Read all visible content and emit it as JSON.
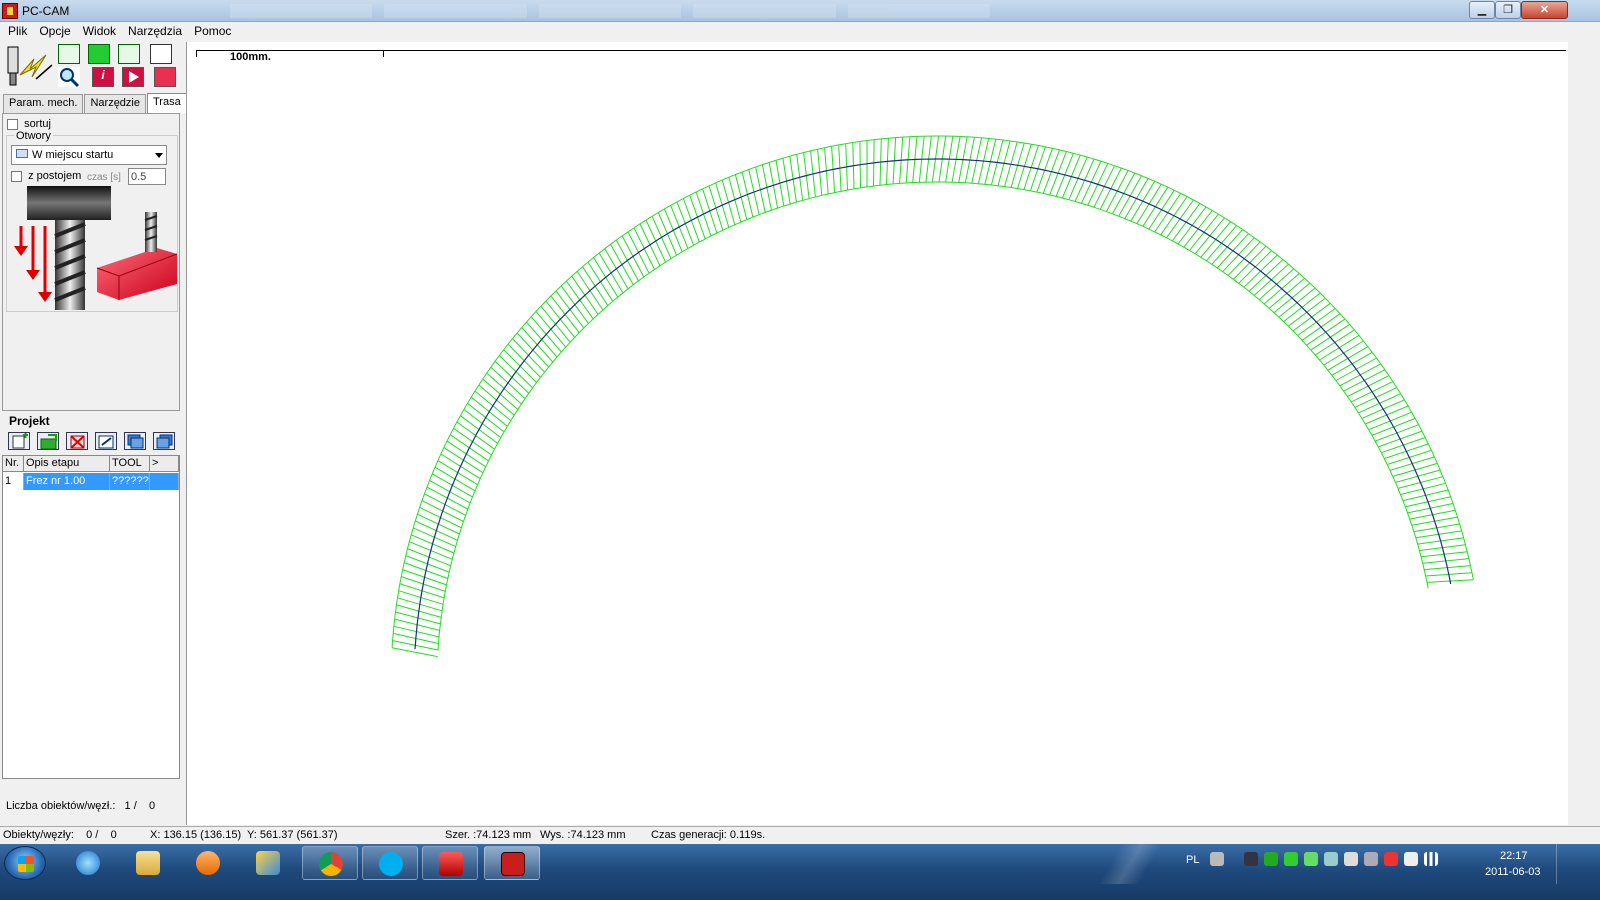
{
  "window": {
    "title": "PC-CAM"
  },
  "menu": [
    "Plik",
    "Opcje",
    "Widok",
    "Narzędzia",
    "Pomoc"
  ],
  "tabs": [
    {
      "label": "Param. mech.",
      "active": false
    },
    {
      "label": "Narzędzie",
      "active": false
    },
    {
      "label": "Trasa",
      "active": true
    }
  ],
  "trasa": {
    "sortuj_label": "sortuj",
    "sortuj_checked": false,
    "otwory_label": "Otwory",
    "otwory_select": "W miejscu startu",
    "postoj_label": "z postojem",
    "postoj_checked": false,
    "czas_label": "czas [s]",
    "czas_value": "0.5"
  },
  "projekt": {
    "title": "Projekt",
    "columns": [
      "Nr.",
      "Opis etapu",
      "TOOL",
      ">"
    ],
    "rows": [
      {
        "nr": "1",
        "opis": "Frez nr 1.00",
        "tool": "??????"
      }
    ],
    "liczba_label": "Liczba obiektów/węzł.:",
    "liczba_value": "1 /    0"
  },
  "canvas": {
    "ruler_label": "100mm."
  },
  "statusbar": {
    "obiekty": "Obiekty/węzły:    0 /    0",
    "x": "X: 136.15 (136.15)",
    "y": "Y: 561.37 (561.37)",
    "szer": "Szer. :74.123 mm",
    "wys": "Wys. :74.123 mm",
    "czas": "Czas generacji: 0.119s."
  },
  "taskbar": {
    "lang": "PL",
    "time": "22:17",
    "date": "2011-06-03"
  },
  "colors": {
    "path": "#1a2a8a",
    "offset": "#22dd22",
    "selection": "#3399ff",
    "close": "#c7452e"
  }
}
